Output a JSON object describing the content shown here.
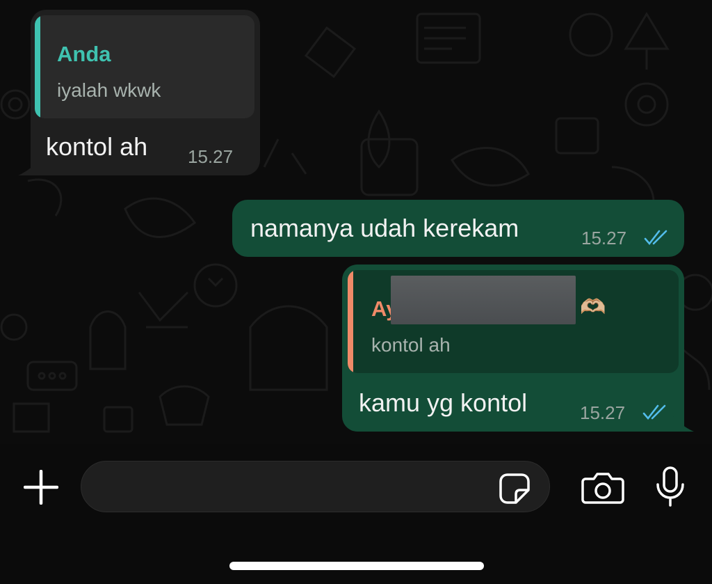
{
  "messages": [
    {
      "direction": "incoming",
      "reply_to": {
        "name": "Anda",
        "text": "iyalah wkwk"
      },
      "text": "kontol ah",
      "time": "15.27"
    },
    {
      "direction": "outgoing",
      "text": "namanya udah kerekam",
      "time": "15.27",
      "status": "read-double-tick"
    },
    {
      "direction": "outgoing",
      "reply_to": {
        "name_visible": "Ay",
        "name_emoji": "🫶🏼",
        "text": "kontol ah",
        "name_redacted": true
      },
      "text": "kamu yg kontol",
      "time": "15.27",
      "status": "read-double-tick"
    }
  ],
  "composer": {
    "icons": [
      "plus-icon",
      "sticker-icon",
      "camera-icon",
      "microphone-icon"
    ],
    "placeholder": ""
  },
  "colors": {
    "incoming_bubble": "#1f1f1f",
    "outgoing_bubble": "#134d37",
    "reply_bar_incoming": "#3fc2b0",
    "reply_name_incoming": "#3fc2b0",
    "reply_bar_outgoing": "#f08a68",
    "reply_name_outgoing": "#f08a68",
    "read_ticks": "#53bdeb"
  }
}
